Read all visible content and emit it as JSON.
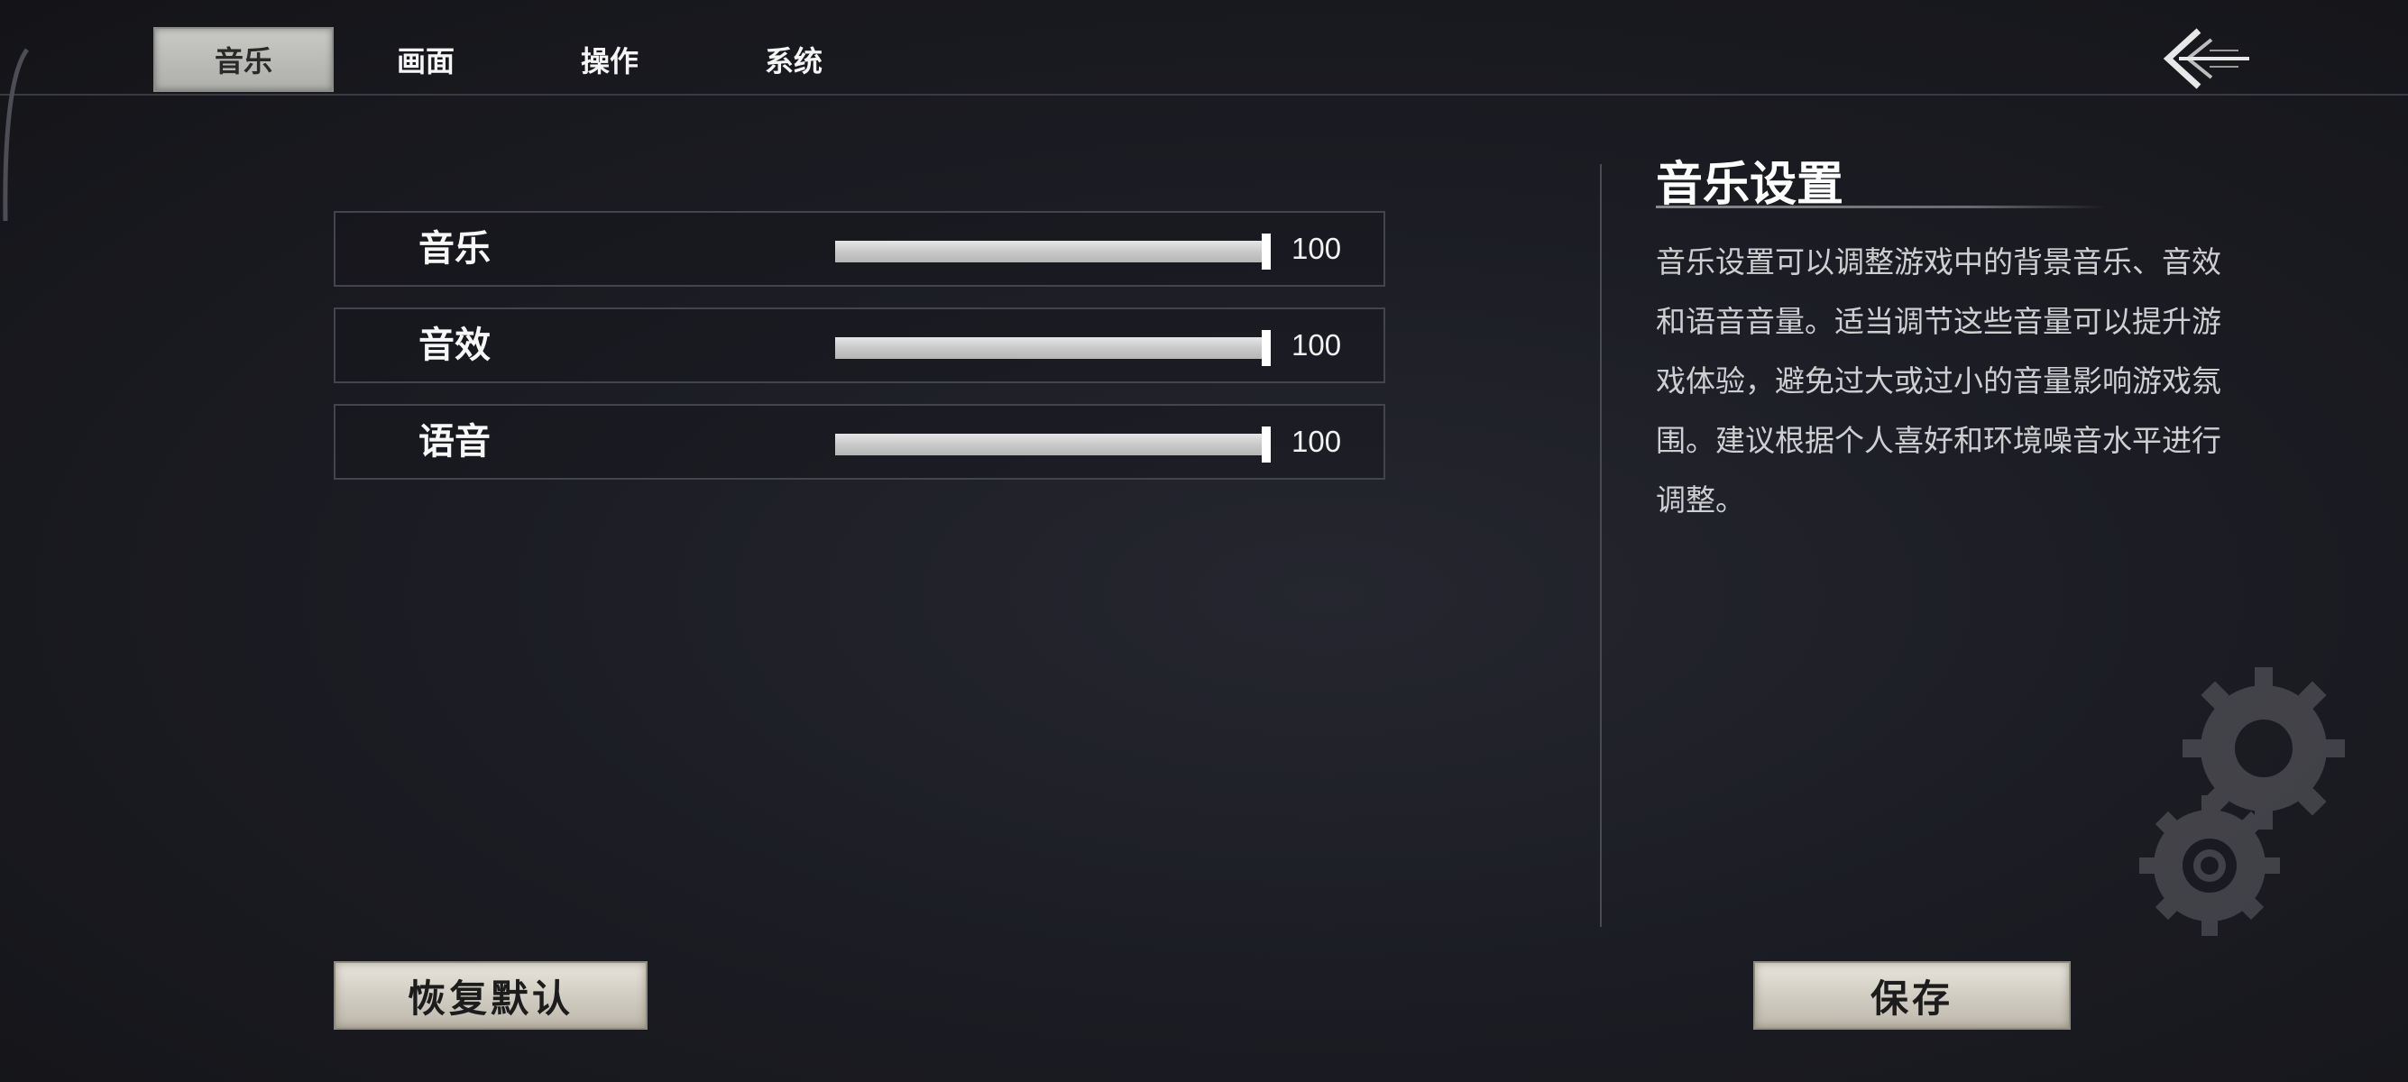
{
  "tabs": [
    {
      "label": "音乐",
      "active": true
    },
    {
      "label": "画面",
      "active": false
    },
    {
      "label": "操作",
      "active": false
    },
    {
      "label": "系统",
      "active": false
    }
  ],
  "back_icon": "back-arrow-icon",
  "sliders": [
    {
      "label": "音乐",
      "value": "100",
      "fraction": 1.0
    },
    {
      "label": "音效",
      "value": "100",
      "fraction": 1.0
    },
    {
      "label": "语音",
      "value": "100",
      "fraction": 1.0
    }
  ],
  "info": {
    "title": "音乐设置",
    "body": "音乐设置可以调整游戏中的背景音乐、音效和语音音量。适当调节这些音量可以提升游戏体验，避免过大或过小的音量影响游戏氛围。建议根据个人喜好和环境噪音水平进行调整。"
  },
  "buttons": {
    "reset_label": "恢复默认",
    "save_label": "保存"
  },
  "decor": {
    "gear_icon": "gear-icon"
  }
}
